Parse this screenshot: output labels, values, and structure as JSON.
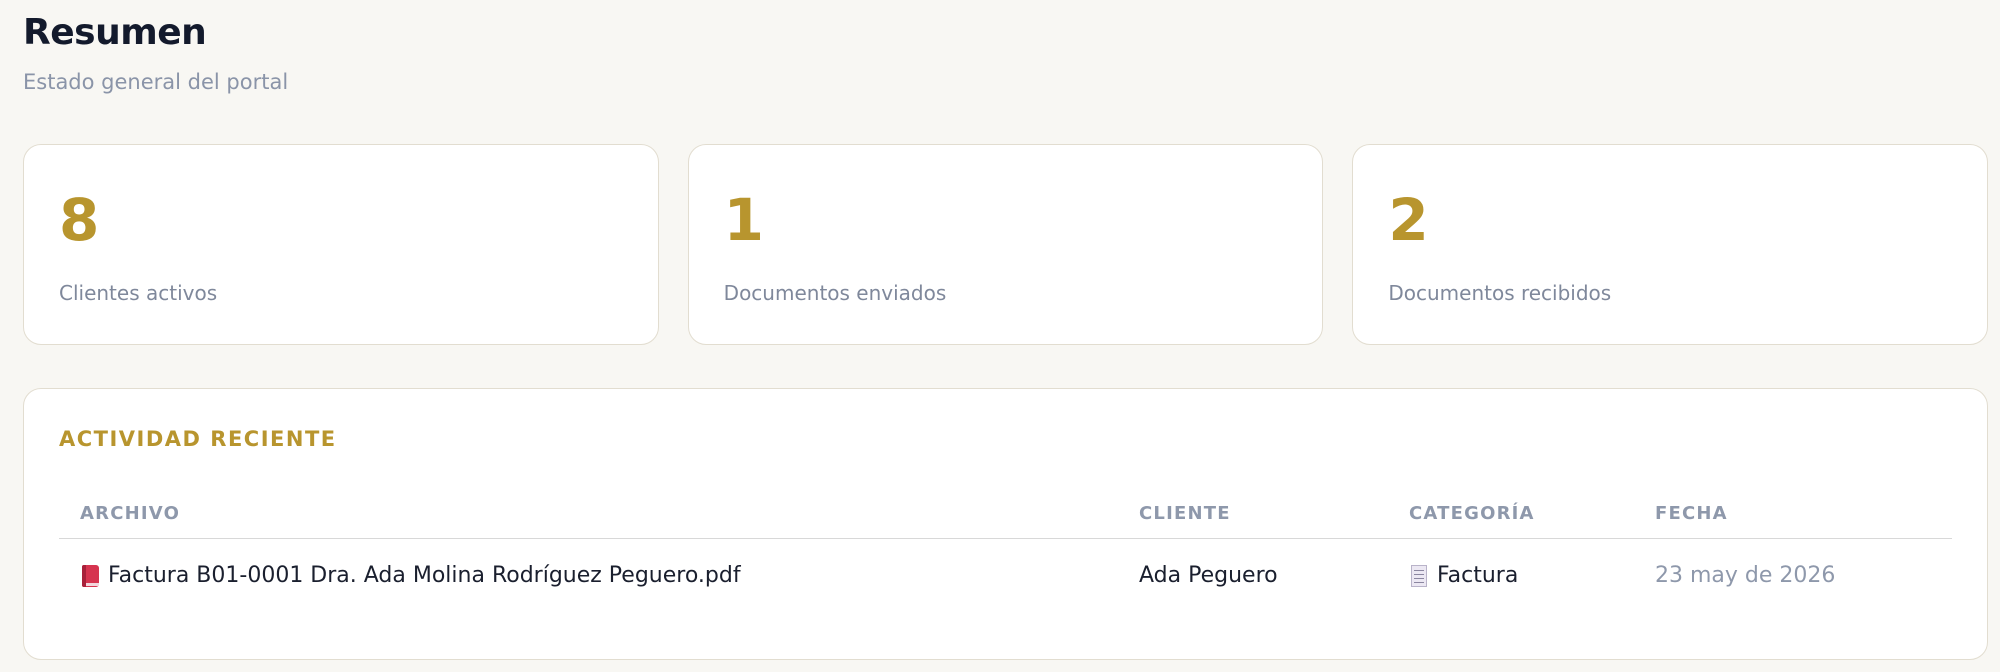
{
  "header": {
    "title": "Resumen",
    "subtitle": "Estado general del portal"
  },
  "stats": [
    {
      "value": "8",
      "label": "Clientes activos"
    },
    {
      "value": "1",
      "label": "Documentos enviados"
    },
    {
      "value": "2",
      "label": "Documentos recibidos"
    }
  ],
  "activity": {
    "title": "ACTIVIDAD RECIENTE",
    "columns": {
      "archivo": "ARCHIVO",
      "cliente": "CLIENTE",
      "categoria": "CATEGORÍA",
      "fecha": "FECHA"
    },
    "rows": [
      {
        "archivo": "Factura B01-0001 Dra. Ada Molina Rodríguez Peguero.pdf",
        "archivo_icon": "pdf-book-icon",
        "cliente": "Ada Peguero",
        "categoria": "Factura",
        "categoria_icon": "receipt-icon",
        "fecha": "23 may de 2026"
      }
    ]
  },
  "colors": {
    "accent": "#b8952e",
    "background": "#f8f7f3",
    "muted_text": "#8e98ab"
  }
}
